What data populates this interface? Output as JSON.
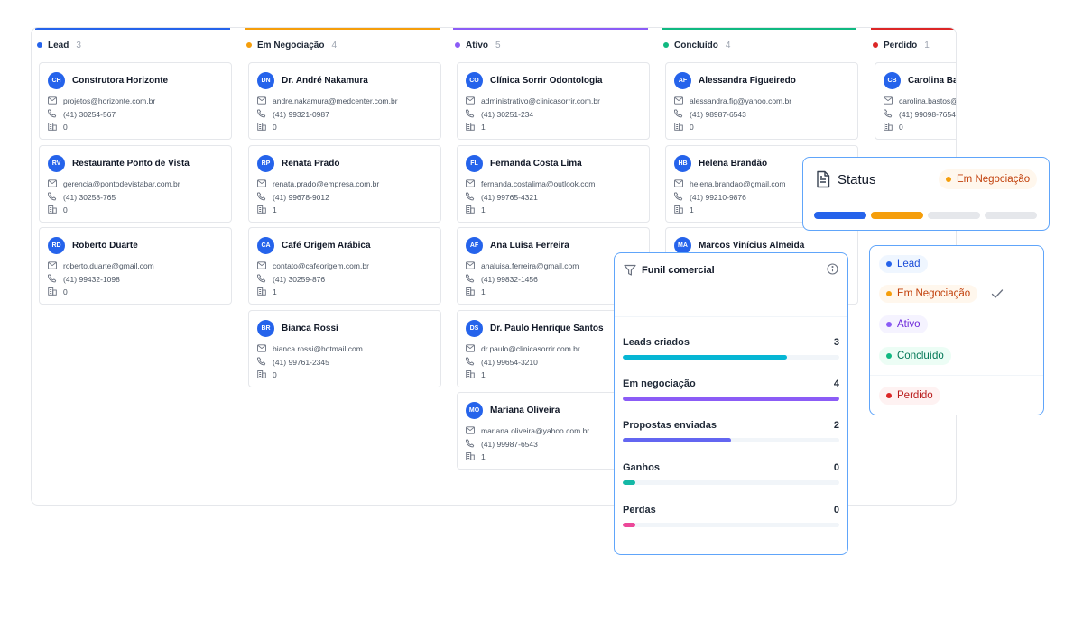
{
  "columns": [
    {
      "id": "lead",
      "name": "Lead",
      "count": "3",
      "color": "#2563eb",
      "cards": [
        {
          "initials": "CH",
          "name": "Construtora Horizonte",
          "email": "projetos@horizonte.com.br",
          "phone": "(41) 30254-567",
          "deals": "0"
        },
        {
          "initials": "RV",
          "name": "Restaurante Ponto de Vista",
          "email": "gerencia@pontodevistabar.com.br",
          "phone": "(41) 30258-765",
          "deals": "0"
        },
        {
          "initials": "RD",
          "name": "Roberto Duarte",
          "email": "roberto.duarte@gmail.com",
          "phone": "(41) 99432-1098",
          "deals": "0"
        }
      ]
    },
    {
      "id": "negociacao",
      "name": "Em Negociação",
      "count": "4",
      "color": "#f59e0b",
      "cards": [
        {
          "initials": "DN",
          "name": "Dr. André Nakamura",
          "email": "andre.nakamura@medcenter.com.br",
          "phone": "(41) 99321-0987",
          "deals": "0"
        },
        {
          "initials": "RP",
          "name": "Renata Prado",
          "email": "renata.prado@empresa.com.br",
          "phone": "(41) 99678-9012",
          "deals": "1"
        },
        {
          "initials": "CA",
          "name": "Café Origem Arábica",
          "email": "contato@cafeorigem.com.br",
          "phone": "(41) 30259-876",
          "deals": "1"
        },
        {
          "initials": "BR",
          "name": "Bianca Rossi",
          "email": "bianca.rossi@hotmail.com",
          "phone": "(41) 99761-2345",
          "deals": "0"
        }
      ]
    },
    {
      "id": "ativo",
      "name": "Ativo",
      "count": "5",
      "color": "#8b5cf6",
      "cards": [
        {
          "initials": "CO",
          "name": "Clínica Sorrir Odontologia",
          "email": "administrativo@clinicasorrir.com.br",
          "phone": "(41) 30251-234",
          "deals": "1"
        },
        {
          "initials": "FL",
          "name": "Fernanda Costa Lima",
          "email": "fernanda.costalima@outlook.com",
          "phone": "(41) 99765-4321",
          "deals": "1"
        },
        {
          "initials": "AF",
          "name": "Ana Luisa Ferreira",
          "email": "analuisa.ferreira@gmail.com",
          "phone": "(41) 99832-1456",
          "deals": "1"
        },
        {
          "initials": "DS",
          "name": "Dr. Paulo Henrique Santos",
          "email": "dr.paulo@clinicasorrir.com.br",
          "phone": "(41) 99654-3210",
          "deals": "1"
        },
        {
          "initials": "MO",
          "name": "Mariana Oliveira",
          "email": "mariana.oliveira@yahoo.com.br",
          "phone": "(41) 99987-6543",
          "deals": "1"
        }
      ]
    },
    {
      "id": "concluido",
      "name": "Concluído",
      "count": "4",
      "color": "#10b981",
      "cards": [
        {
          "initials": "AF",
          "name": "Alessandra Figueiredo",
          "email": "alessandra.fig@yahoo.com.br",
          "phone": "(41) 98987-6543",
          "deals": "0"
        },
        {
          "initials": "HB",
          "name": "Helena Brandão",
          "email": "helena.brandao@gmail.com",
          "phone": "(41) 99210-9876",
          "deals": "1"
        },
        {
          "initials": "MA",
          "name": "Marcos Vinícius Almeida",
          "email": "",
          "phone": "",
          "deals": ""
        }
      ]
    },
    {
      "id": "perdido",
      "name": "Perdido",
      "count": "1",
      "color": "#dc2626",
      "cards": [
        {
          "initials": "CB",
          "name": "Carolina Bastos",
          "email": "carolina.bastos@gmail.com",
          "phone": "(41) 99098-7654",
          "deals": "0"
        }
      ]
    }
  ],
  "status": {
    "title": "Status",
    "current": "Em Negociação",
    "current_color": "#f59e0b",
    "progress_colors": [
      "#2563eb",
      "#f59e0b",
      "#e5e7eb",
      "#e5e7eb"
    ]
  },
  "status_options": [
    {
      "label": "Lead",
      "dot": "#2563eb",
      "text": "#1d4ed8",
      "bg": "#eff6ff",
      "selected": false
    },
    {
      "label": "Em Negociação",
      "dot": "#f59e0b",
      "text": "#c2410c",
      "bg": "#fff7ed",
      "selected": true
    },
    {
      "label": "Ativo",
      "dot": "#8b5cf6",
      "text": "#6d28d9",
      "bg": "#f5f3ff",
      "selected": false
    },
    {
      "label": "Concluído",
      "dot": "#10b981",
      "text": "#047857",
      "bg": "#ecfdf5",
      "selected": false
    },
    {
      "label": "Perdido",
      "dot": "#dc2626",
      "text": "#b91c1c",
      "bg": "#fef2f2",
      "selected": false
    }
  ],
  "funnel": {
    "title": "Funil comercial",
    "rows": [
      {
        "label": "Leads criados",
        "value": "3",
        "fraction": 0.76,
        "color": "#06b6d4"
      },
      {
        "label": "Em negociação",
        "value": "4",
        "fraction": 1.0,
        "color": "#8b5cf6"
      },
      {
        "label": "Propostas enviadas",
        "value": "2",
        "fraction": 0.5,
        "color": "#6366f1"
      },
      {
        "label": "Ganhos",
        "value": "0",
        "fraction": 0.06,
        "color": "#14b8a6"
      },
      {
        "label": "Perdas",
        "value": "0",
        "fraction": 0.06,
        "color": "#ec4899"
      }
    ]
  }
}
